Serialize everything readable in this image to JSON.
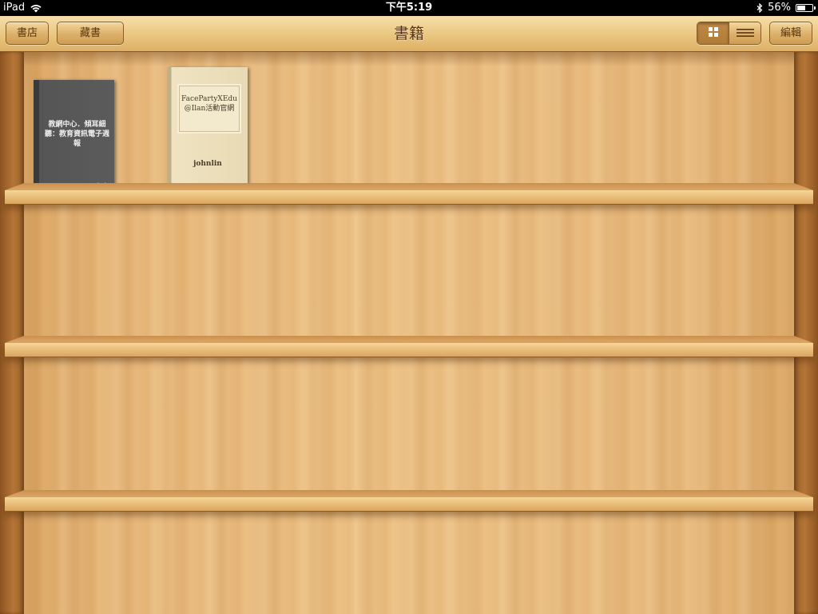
{
  "status_bar": {
    "device": "iPad",
    "time": "下午5:19",
    "battery": "56%",
    "battery_level": 0.56
  },
  "nav": {
    "title": "書籍",
    "store_label": "書店",
    "collections_label": "藏書",
    "edit_label": "編輯",
    "view_mode": "grid"
  },
  "books": [
    {
      "title": "教網中心．傾耳細聽：教育資訊電子週報",
      "logo": "CamScan"
    },
    {
      "title": "FacePartyXEdu@Ilan活動官網",
      "author": "johnlin"
    }
  ],
  "colors": {
    "nav_text": "#5a3510",
    "wood": "#e8b878",
    "status_bg": "#000000"
  }
}
